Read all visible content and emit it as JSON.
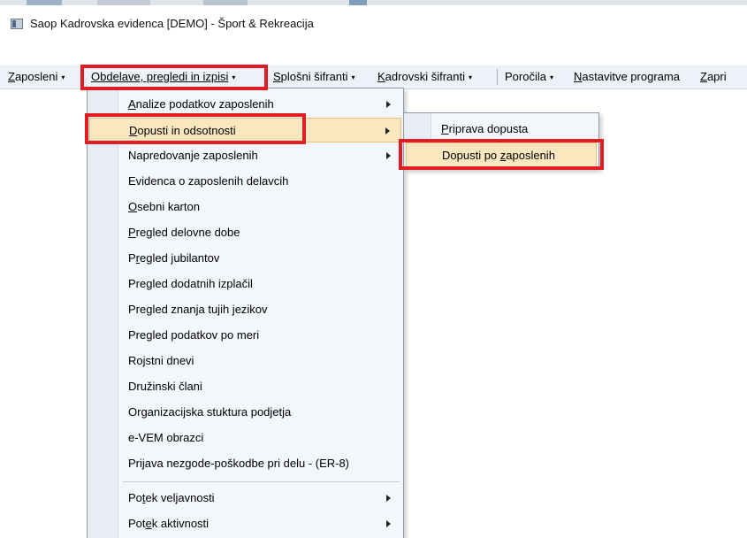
{
  "window": {
    "title": "Saop Kadrovska evidenca  [DEMO] - Šport & Rekreacija"
  },
  "menubar": {
    "items": [
      {
        "u": "Z",
        "rest": "aposleni",
        "arrow": "▾"
      },
      {
        "u": "O",
        "rest": "bdelave, pregledi in izpisi",
        "arrow": "▾"
      },
      {
        "u": "S",
        "rest": "plošni šifranti",
        "arrow": "▾"
      },
      {
        "u": "K",
        "rest": "adrovski šifranti",
        "arrow": "▾"
      },
      {
        "u": "",
        "rest": "Poročila",
        "arrow": "▾"
      },
      {
        "u": "N",
        "rest": "astavitve programa"
      },
      {
        "u": "Z",
        "rest": "apri"
      }
    ]
  },
  "dropdown": {
    "items": [
      {
        "pre": "",
        "u": "A",
        "post": "nalize podatkov zaposlenih"
      },
      {
        "pre": "",
        "u": "D",
        "post": "opusti in odsotnosti"
      },
      {
        "pre": "Napredovanje zaposlenih",
        "u": "",
        "post": ""
      },
      {
        "pre": "Evidenca o zaposlenih delavcih",
        "u": "",
        "post": ""
      },
      {
        "pre": "",
        "u": "O",
        "post": "sebni karton"
      },
      {
        "pre": "",
        "u": "P",
        "post": "regled delovne dobe"
      },
      {
        "pre": "P",
        "u": "r",
        "post": "egled jubilantov"
      },
      {
        "pre": "Pregled dodatnih izplačil",
        "u": "",
        "post": ""
      },
      {
        "pre": "Pregled znanja tujih jezikov",
        "u": "",
        "post": ""
      },
      {
        "pre": "Pregled podatkov po meri",
        "u": "",
        "post": ""
      },
      {
        "pre": "Ro",
        "u": "j",
        "post": "stni dnevi"
      },
      {
        "pre": "Družinski člani",
        "u": "",
        "post": ""
      },
      {
        "pre": "Organizacijska stuktura podjetja",
        "u": "",
        "post": ""
      },
      {
        "pre": "e-VEM obrazci",
        "u": "",
        "post": ""
      },
      {
        "pre": "Prijava nezgode-poškodbe pri delu - (ER-8)",
        "u": "",
        "post": ""
      },
      {
        "pre": "Po",
        "u": "t",
        "post": "ek veljavnosti"
      },
      {
        "pre": "Pot",
        "u": "e",
        "post": "k aktivnosti"
      }
    ]
  },
  "submenu": {
    "items": [
      {
        "pre": "",
        "u": "P",
        "post": "riprava dopusta"
      },
      {
        "pre": "Dopusti po ",
        "u": "z",
        "post": "aposlenih"
      }
    ]
  }
}
